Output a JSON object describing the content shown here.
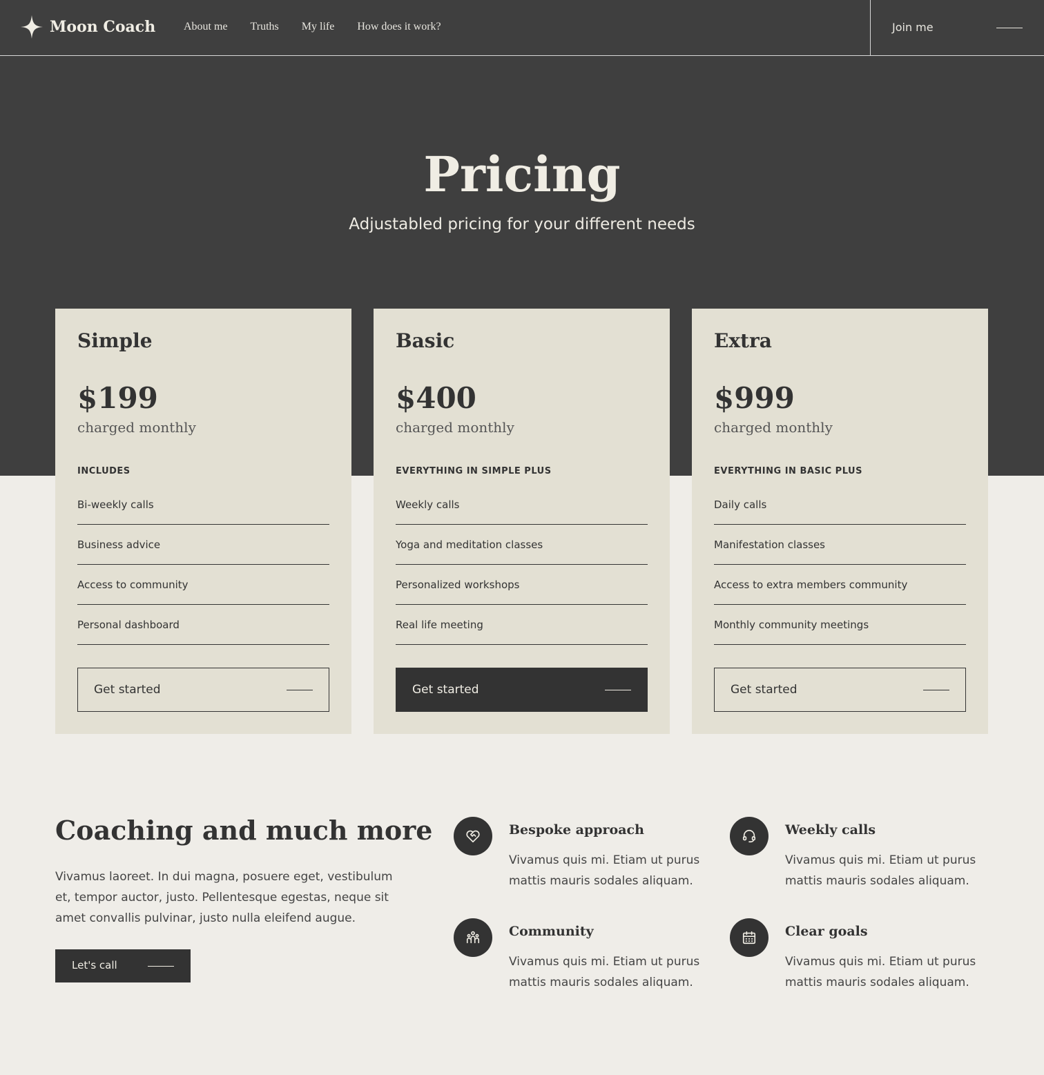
{
  "brand": {
    "name": "Moon Coach"
  },
  "nav": {
    "links": [
      "About me",
      "Truths",
      "My life",
      "How does it work?"
    ]
  },
  "header": {
    "join_label": "Join me"
  },
  "hero": {
    "title": "Pricing",
    "subtitle": "Adjustabled pricing for your different needs"
  },
  "plans": [
    {
      "name": "Simple",
      "price": "$199",
      "period": "charged monthly",
      "includes_label": "INCLUDES",
      "features": [
        "Bi-weekly calls",
        "Business advice",
        "Access to community",
        "Personal dashboard"
      ],
      "cta": "Get started",
      "highlighted": false
    },
    {
      "name": "Basic",
      "price": "$400",
      "period": "charged monthly",
      "includes_label": "EVERYTHING IN SIMPLE PLUS",
      "features": [
        "Weekly calls",
        "Yoga and meditation classes",
        "Personalized workshops",
        "Real life meeting"
      ],
      "cta": "Get started",
      "highlighted": true
    },
    {
      "name": "Extra",
      "price": "$999",
      "period": "charged monthly",
      "includes_label": "EVERYTHING IN BASIC PLUS",
      "features": [
        "Daily calls",
        "Manifestation classes",
        "Access to extra members community",
        "Monthly community meetings"
      ],
      "cta": "Get started",
      "highlighted": false
    }
  ],
  "coaching": {
    "title": "Coaching and much more",
    "description": "Vivamus laoreet. In dui magna, posuere eget, vestibulum et, tempor auctor, justo. Pellentesque egestas, neque sit amet convallis pulvinar, justo nulla eleifend augue.",
    "cta": "Let's call"
  },
  "benefits": [
    {
      "title": "Bespoke approach",
      "description": "Vivamus quis mi. Etiam ut purus mattis mauris sodales aliquam.",
      "icon": "heart-handshake-icon"
    },
    {
      "title": "Weekly calls",
      "description": "Vivamus quis mi. Etiam ut purus mattis mauris sodales aliquam.",
      "icon": "headset-icon"
    },
    {
      "title": "Community",
      "description": "Vivamus quis mi. Etiam ut purus mattis mauris sodales aliquam.",
      "icon": "people-icon"
    },
    {
      "title": "Clear goals",
      "description": "Vivamus quis mi. Etiam ut purus mattis mauris sodales aliquam.",
      "icon": "calendar-icon"
    }
  ],
  "colors": {
    "dark": "#3f3f3f",
    "card": "#e3e0d3",
    "background": "#efede8",
    "ink": "#333333",
    "cream": "#f0ede4"
  }
}
